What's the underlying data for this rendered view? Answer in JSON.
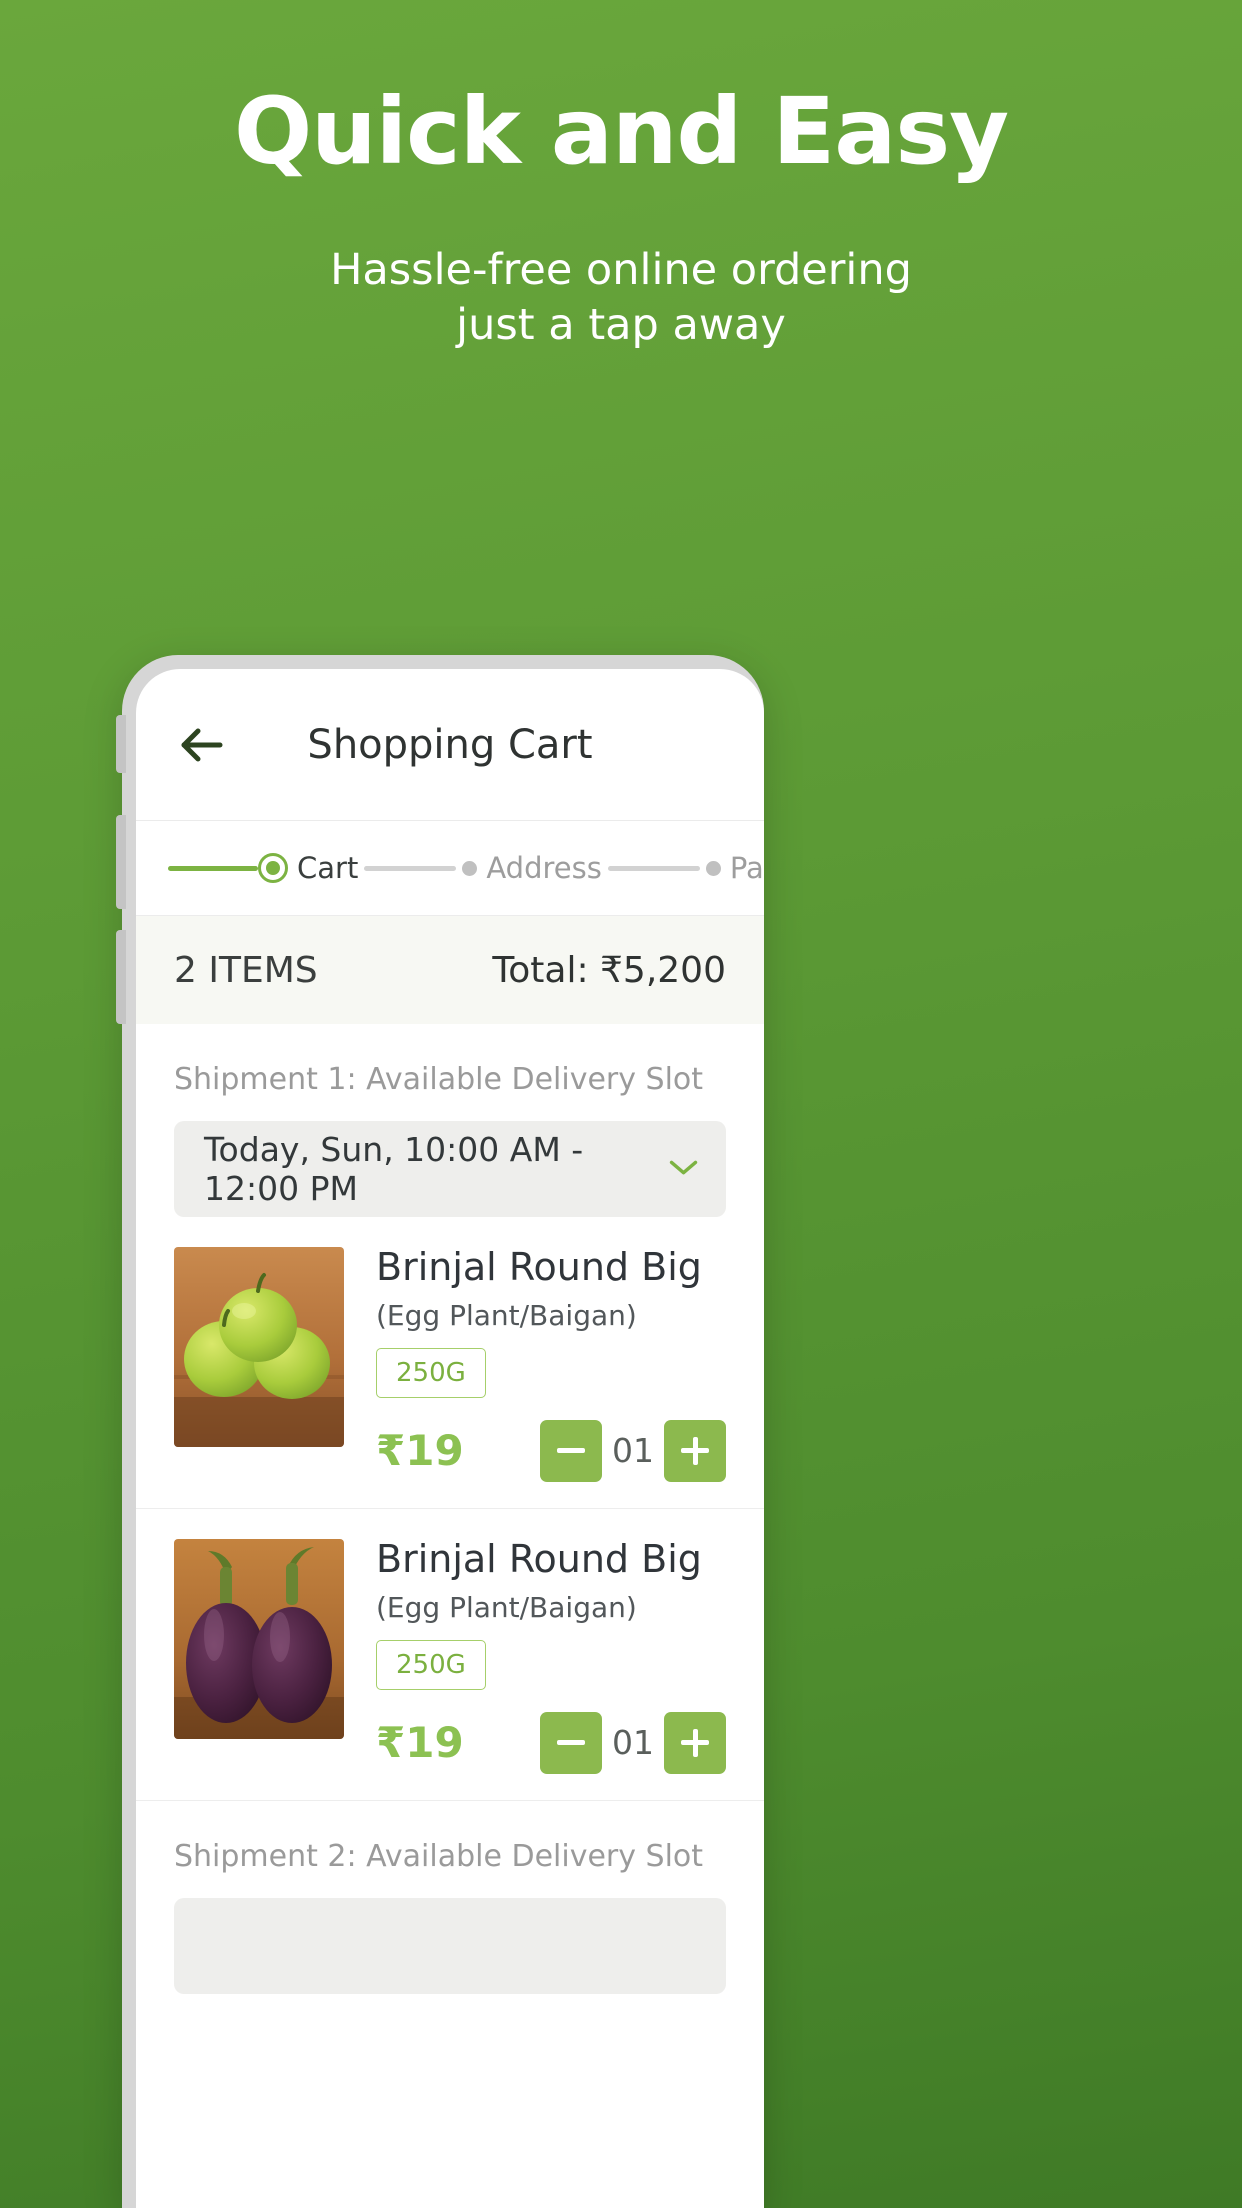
{
  "promo": {
    "title": "Quick and Easy",
    "subtitle_line1": "Hassle-free online ordering",
    "subtitle_line2": "just a tap away"
  },
  "appbar": {
    "back_icon": "arrow-left-icon",
    "title": "Shopping Cart"
  },
  "stepper": {
    "steps": [
      {
        "label": "Cart",
        "state": "active"
      },
      {
        "label": "Address",
        "state": "idle"
      },
      {
        "label": "Payment",
        "state": "idle"
      }
    ]
  },
  "summary": {
    "items_count": "2 ITEMS",
    "total": "Total: ₹5,200"
  },
  "shipments": [
    {
      "label": "Shipment 1: Available Delivery Slot",
      "slot": "Today,  Sun, 10:00 AM - 12:00 PM",
      "chevron_icon": "chevron-down-icon"
    },
    {
      "label": "Shipment 2: Available Delivery Slot"
    }
  ],
  "products": [
    {
      "image": "green-brinjal-photo",
      "name": "Brinjal Round Big",
      "variant": "(Egg Plant/Baigan)",
      "weight": "250G",
      "price": "₹19",
      "qty": "01",
      "minus_icon": "minus-icon",
      "plus_icon": "plus-icon"
    },
    {
      "image": "purple-brinjal-photo",
      "name": "Brinjal Round Big",
      "variant": "(Egg Plant/Baigan)",
      "weight": "250G",
      "price": "₹19",
      "qty": "01",
      "minus_icon": "minus-icon",
      "plus_icon": "plus-icon"
    }
  ],
  "colors": {
    "brand_green": "#5c9a35",
    "accent_green": "#8cb94e",
    "price_green": "#8cc152",
    "muted_text": "#9a9a9a"
  }
}
